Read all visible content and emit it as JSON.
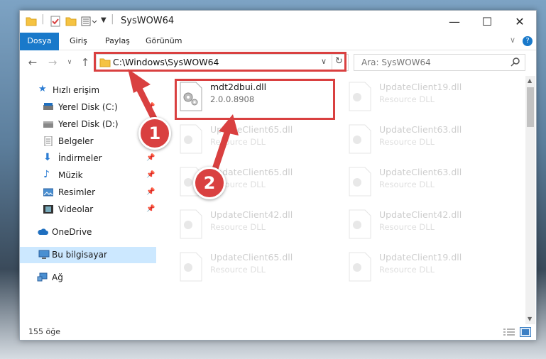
{
  "window": {
    "title": "SysWOW64"
  },
  "ribbon": {
    "tabs": [
      "Dosya",
      "Giriş",
      "Paylaş",
      "Görünüm"
    ]
  },
  "address": {
    "path": "C:\\Windows\\SysWOW64",
    "search_placeholder": "Ara: SysWOW64"
  },
  "sidebar": {
    "items": [
      {
        "label": "Hızlı erişim",
        "icon": "star-icon"
      },
      {
        "label": "Yerel Disk (C:)",
        "icon": "drive-icon",
        "pinned": true
      },
      {
        "label": "Yerel Disk (D:)",
        "icon": "drive-icon"
      },
      {
        "label": "Belgeler",
        "icon": "documents-icon",
        "pinned": true
      },
      {
        "label": "İndirmeler",
        "icon": "download-icon",
        "pinned": true
      },
      {
        "label": "Müzik",
        "icon": "music-icon",
        "pinned": true
      },
      {
        "label": "Resimler",
        "icon": "pictures-icon",
        "pinned": true
      },
      {
        "label": "Videolar",
        "icon": "videos-icon",
        "pinned": true
      },
      {
        "label": "OneDrive",
        "icon": "cloud-icon"
      },
      {
        "label": "Bu bilgisayar",
        "icon": "computer-icon",
        "selected": true
      },
      {
        "label": "Ağ",
        "icon": "network-icon"
      }
    ]
  },
  "files": {
    "highlighted": {
      "name": "mdt2dbui.dll",
      "detail": "2.0.0.8908"
    },
    "others": [
      {
        "name": "UpdateClient19.dll",
        "detail": "Resource DLL"
      },
      {
        "name": "UpdateClient65.dll",
        "detail": "Resource DLL"
      },
      {
        "name": "UpdateClient63.dll",
        "detail": "Resource DLL"
      },
      {
        "name": "UpdateClient65.dll",
        "detail": "Resource DLL"
      },
      {
        "name": "UpdateClient63.dll",
        "detail": "Resource DLL"
      },
      {
        "name": "UpdateClient42.dll",
        "detail": "Resource DLL"
      },
      {
        "name": "UpdateClient42.dll",
        "detail": "Resource DLL"
      },
      {
        "name": "UpdateClient65.dll",
        "detail": "Resource DLL"
      },
      {
        "name": "UpdateClient19.dll",
        "detail": "Resource DLL"
      }
    ]
  },
  "status": {
    "count": "155 öğe"
  },
  "annotations": {
    "step1": "1",
    "step2": "2"
  },
  "colors": {
    "accent": "#1979ca",
    "highlight": "#d94040",
    "selected_bg": "#cce8ff"
  }
}
